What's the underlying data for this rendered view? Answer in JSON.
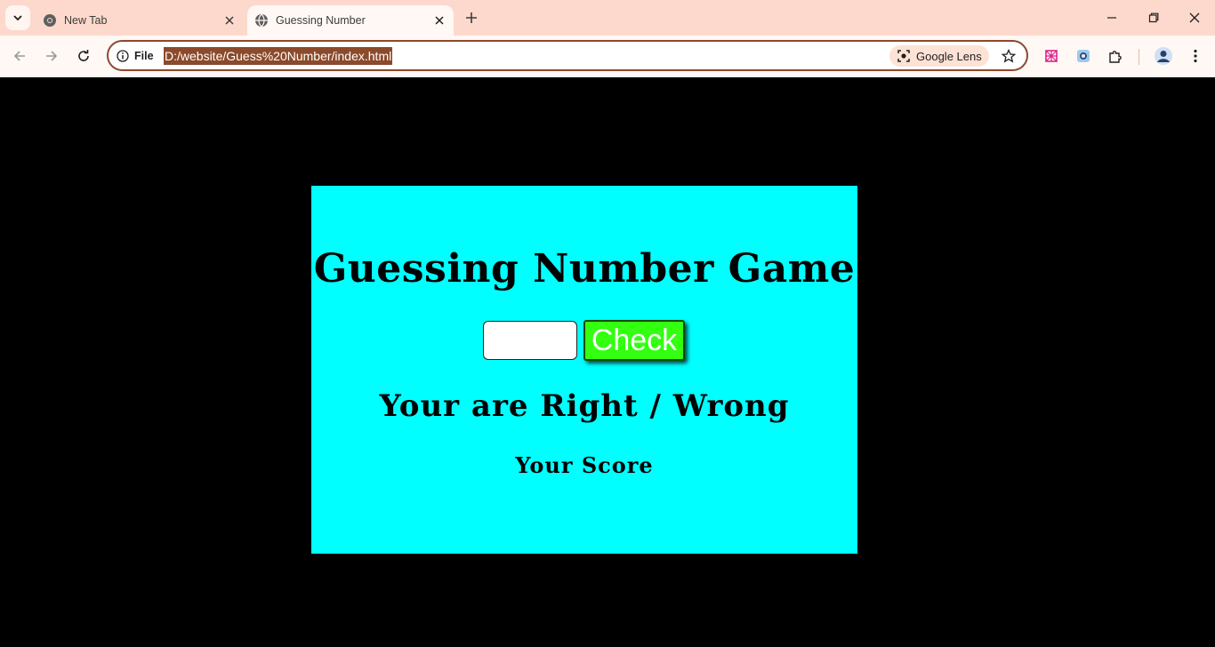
{
  "browser": {
    "tabs": [
      {
        "title": "New Tab",
        "favicon": "chrome-icon",
        "active": false
      },
      {
        "title": "Guessing Number",
        "favicon": "globe-icon",
        "active": true
      }
    ],
    "address_bar": {
      "site_info_label": "File",
      "url": "D:/website/Guess%20Number/index.html",
      "lens_label": "Google Lens"
    },
    "colors": {
      "tabstrip": "#fcd9cc",
      "toolbar": "#fff8f5",
      "url_highlight": "#8b4a2b"
    }
  },
  "game": {
    "title": "Guessing Number Game",
    "input_value": "",
    "check_label": "Check",
    "result_text": "Your are Right / Wrong",
    "score_text": "Your Score",
    "colors": {
      "card_background": "#00ffff",
      "page_background": "#000000",
      "button_background": "#33ff11",
      "button_text": "#ffffff"
    }
  }
}
